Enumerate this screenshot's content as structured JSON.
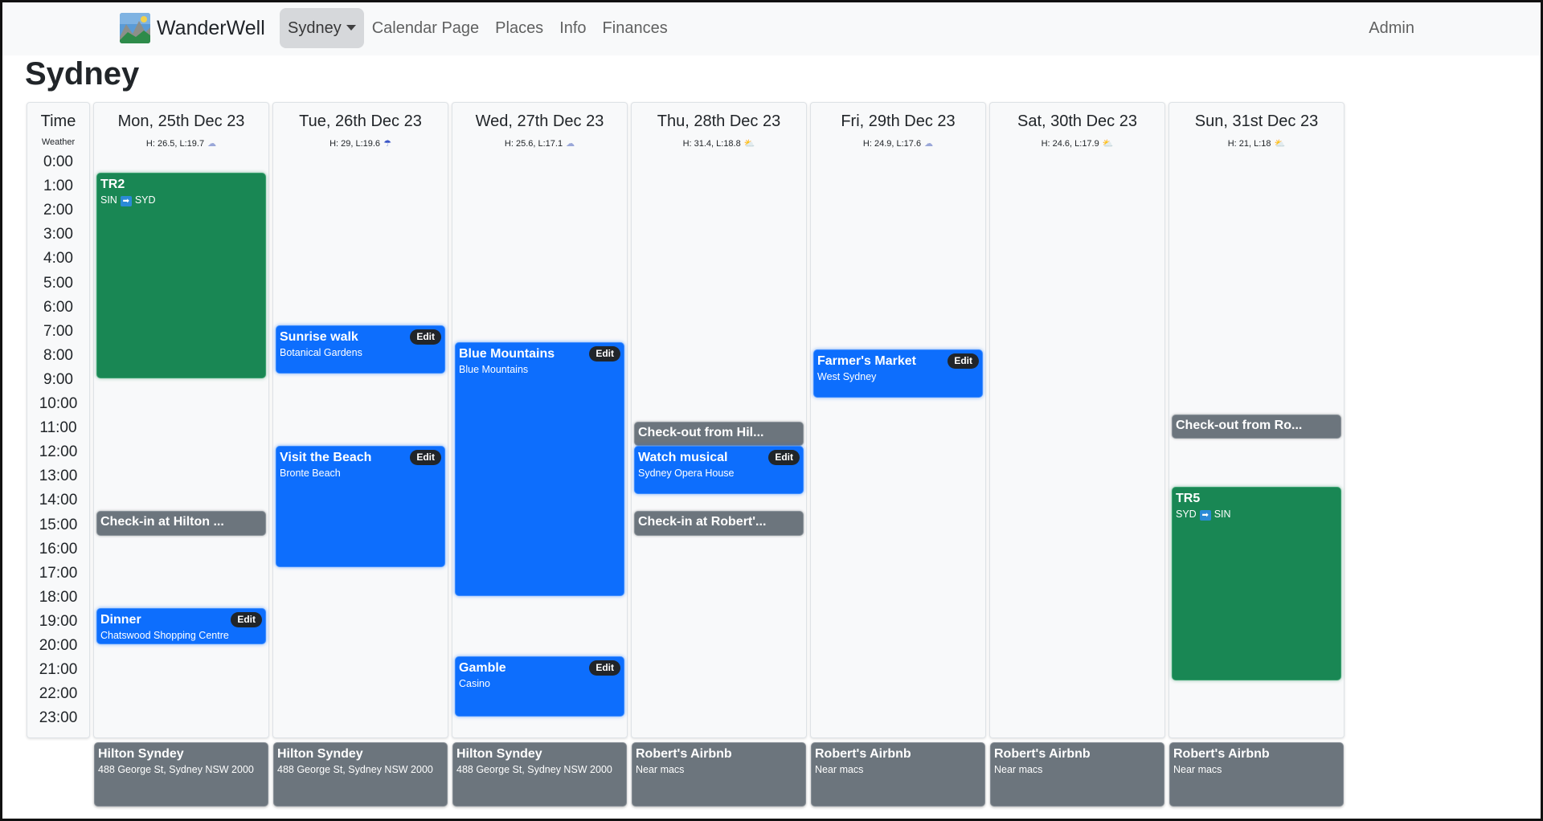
{
  "app": {
    "brand": "WanderWell"
  },
  "nav": {
    "city": "Sydney",
    "items": [
      {
        "label": "Calendar Page"
      },
      {
        "label": "Places"
      },
      {
        "label": "Info"
      },
      {
        "label": "Finances"
      }
    ],
    "admin": "Admin"
  },
  "page": {
    "title": "Sydney"
  },
  "time_col": {
    "header": "Time",
    "weather_label": "Weather",
    "hours": [
      "0:00",
      "1:00",
      "2:00",
      "3:00",
      "4:00",
      "5:00",
      "6:00",
      "7:00",
      "8:00",
      "9:00",
      "10:00",
      "11:00",
      "12:00",
      "13:00",
      "14:00",
      "15:00",
      "16:00",
      "17:00",
      "18:00",
      "19:00",
      "20:00",
      "21:00",
      "22:00",
      "23:00"
    ]
  },
  "edit_label": "Edit",
  "days": [
    {
      "date": "Mon, 25th Dec 23",
      "weather": "H: 26.5, L:19.7",
      "weather_icon": "cloud-icon",
      "events": [
        {
          "kind": "travel",
          "title": "TR2",
          "from": "SIN",
          "to": "SYD",
          "start": 0.5,
          "end": 9.0
        },
        {
          "kind": "stay",
          "title": "Check-in at Hilton ...",
          "start": 14.5,
          "end": 15.5
        },
        {
          "kind": "activity",
          "title": "Dinner",
          "sub": "Chatswood Shopping Centre",
          "start": 18.5,
          "end": 20.0
        }
      ],
      "stay": {
        "name": "Hilton Syndey",
        "address": "488 George St, Sydney NSW 2000"
      }
    },
    {
      "date": "Tue, 26th Dec 23",
      "weather": "H: 29, L:19.6",
      "weather_icon": "rain-cloud-icon",
      "events": [
        {
          "kind": "activity",
          "title": "Sunrise walk",
          "sub": "Botanical Gardens",
          "start": 6.8,
          "end": 8.8
        },
        {
          "kind": "activity",
          "title": "Visit the Beach",
          "sub": "Bronte Beach",
          "start": 11.8,
          "end": 16.8
        }
      ],
      "stay": {
        "name": "Hilton Syndey",
        "address": "488 George St, Sydney NSW 2000"
      }
    },
    {
      "date": "Wed, 27th Dec 23",
      "weather": "H: 25.6, L:17.1",
      "weather_icon": "cloud-icon",
      "events": [
        {
          "kind": "activity",
          "title": "Blue Mountains",
          "sub": "Blue Mountains",
          "start": 7.5,
          "end": 18.0
        },
        {
          "kind": "activity",
          "title": "Gamble",
          "sub": "Casino",
          "start": 20.5,
          "end": 23.0
        }
      ],
      "stay": {
        "name": "Hilton Syndey",
        "address": "488 George St, Sydney NSW 2000"
      }
    },
    {
      "date": "Thu, 28th Dec 23",
      "weather": "H: 31.4, L:18.8",
      "weather_icon": "sun-cloud-icon",
      "events": [
        {
          "kind": "stay",
          "title": "Check-out from Hil...",
          "start": 10.8,
          "end": 11.8
        },
        {
          "kind": "activity",
          "title": "Watch musical",
          "sub": "Sydney Opera House",
          "start": 11.8,
          "end": 13.8
        },
        {
          "kind": "stay",
          "title": "Check-in at Robert'...",
          "start": 14.5,
          "end": 15.5
        }
      ],
      "stay": {
        "name": "Robert's Airbnb",
        "address": "Near macs"
      }
    },
    {
      "date": "Fri, 29th Dec 23",
      "weather": "H: 24.9, L:17.6",
      "weather_icon": "cloud-icon",
      "events": [
        {
          "kind": "activity",
          "title": "Farmer's Market",
          "sub": "West Sydney",
          "start": 7.8,
          "end": 9.8
        }
      ],
      "stay": {
        "name": "Robert's Airbnb",
        "address": "Near macs"
      }
    },
    {
      "date": "Sat, 30th Dec 23",
      "weather": "H: 24.6, L:17.9",
      "weather_icon": "sun-cloud-icon",
      "events": [],
      "stay": {
        "name": "Robert's Airbnb",
        "address": "Near macs"
      }
    },
    {
      "date": "Sun, 31st Dec 23",
      "weather": "H: 21, L:18",
      "weather_icon": "sun-cloud-icon",
      "events": [
        {
          "kind": "stay",
          "title": "Check-out from Ro...",
          "start": 10.5,
          "end": 11.5
        },
        {
          "kind": "travel",
          "title": "TR5",
          "from": "SYD",
          "to": "SIN",
          "start": 13.5,
          "end": 21.5
        }
      ],
      "stay": {
        "name": "Robert's Airbnb",
        "address": "Near macs"
      }
    }
  ]
}
